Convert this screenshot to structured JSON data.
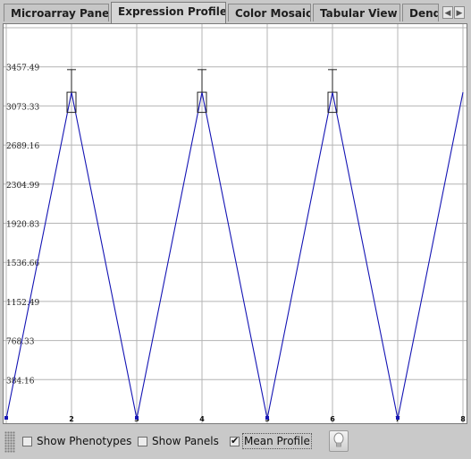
{
  "tabs": [
    {
      "label": "Microarray Panel",
      "selected": false
    },
    {
      "label": "Expression Profiles",
      "selected": true
    },
    {
      "label": "Color Mosaic",
      "selected": false
    },
    {
      "label": "Tabular View",
      "selected": false
    },
    {
      "label": "Dendr",
      "selected": false
    }
  ],
  "tab_scroll": {
    "left_icon": "chevron-left-icon",
    "right_icon": "chevron-right-icon",
    "left_glyph": "◀",
    "right_glyph": "▶"
  },
  "bottom": {
    "show_phenotypes": {
      "label": "Show Phenotypes",
      "checked": false
    },
    "show_panels": {
      "label": "Show Panels",
      "checked": false
    },
    "mean_profile": {
      "label": "Mean Profile",
      "checked": true
    },
    "hint_icon": "lightbulb-icon"
  },
  "chart_data": {
    "type": "line",
    "title": "",
    "xlabel": "",
    "ylabel": "",
    "x": [
      1,
      2,
      3,
      4,
      5,
      6,
      7,
      8
    ],
    "x_tick_labels": [
      "2",
      "3",
      "4",
      "5",
      "6",
      "7",
      "8"
    ],
    "y_tick_labels": [
      "3457.49",
      "3073.33",
      "2689.16",
      "2304.99",
      "1920.83",
      "1536.66",
      "1152.49",
      "768.33",
      "384.16"
    ],
    "ylim": [
      0,
      3841.65
    ],
    "grid": true,
    "series": [
      {
        "values": [
          0,
          3208,
          0,
          3208,
          0,
          3208,
          0,
          3208
        ],
        "color": "#1414b4"
      }
    ],
    "error_bars": [
      {
        "x": 2,
        "center": 3208,
        "high": 3430,
        "low": 3010
      },
      {
        "x": 4,
        "center": 3208,
        "high": 3430,
        "low": 3010
      },
      {
        "x": 6,
        "center": 3208,
        "high": 3430,
        "low": 3010
      }
    ]
  }
}
